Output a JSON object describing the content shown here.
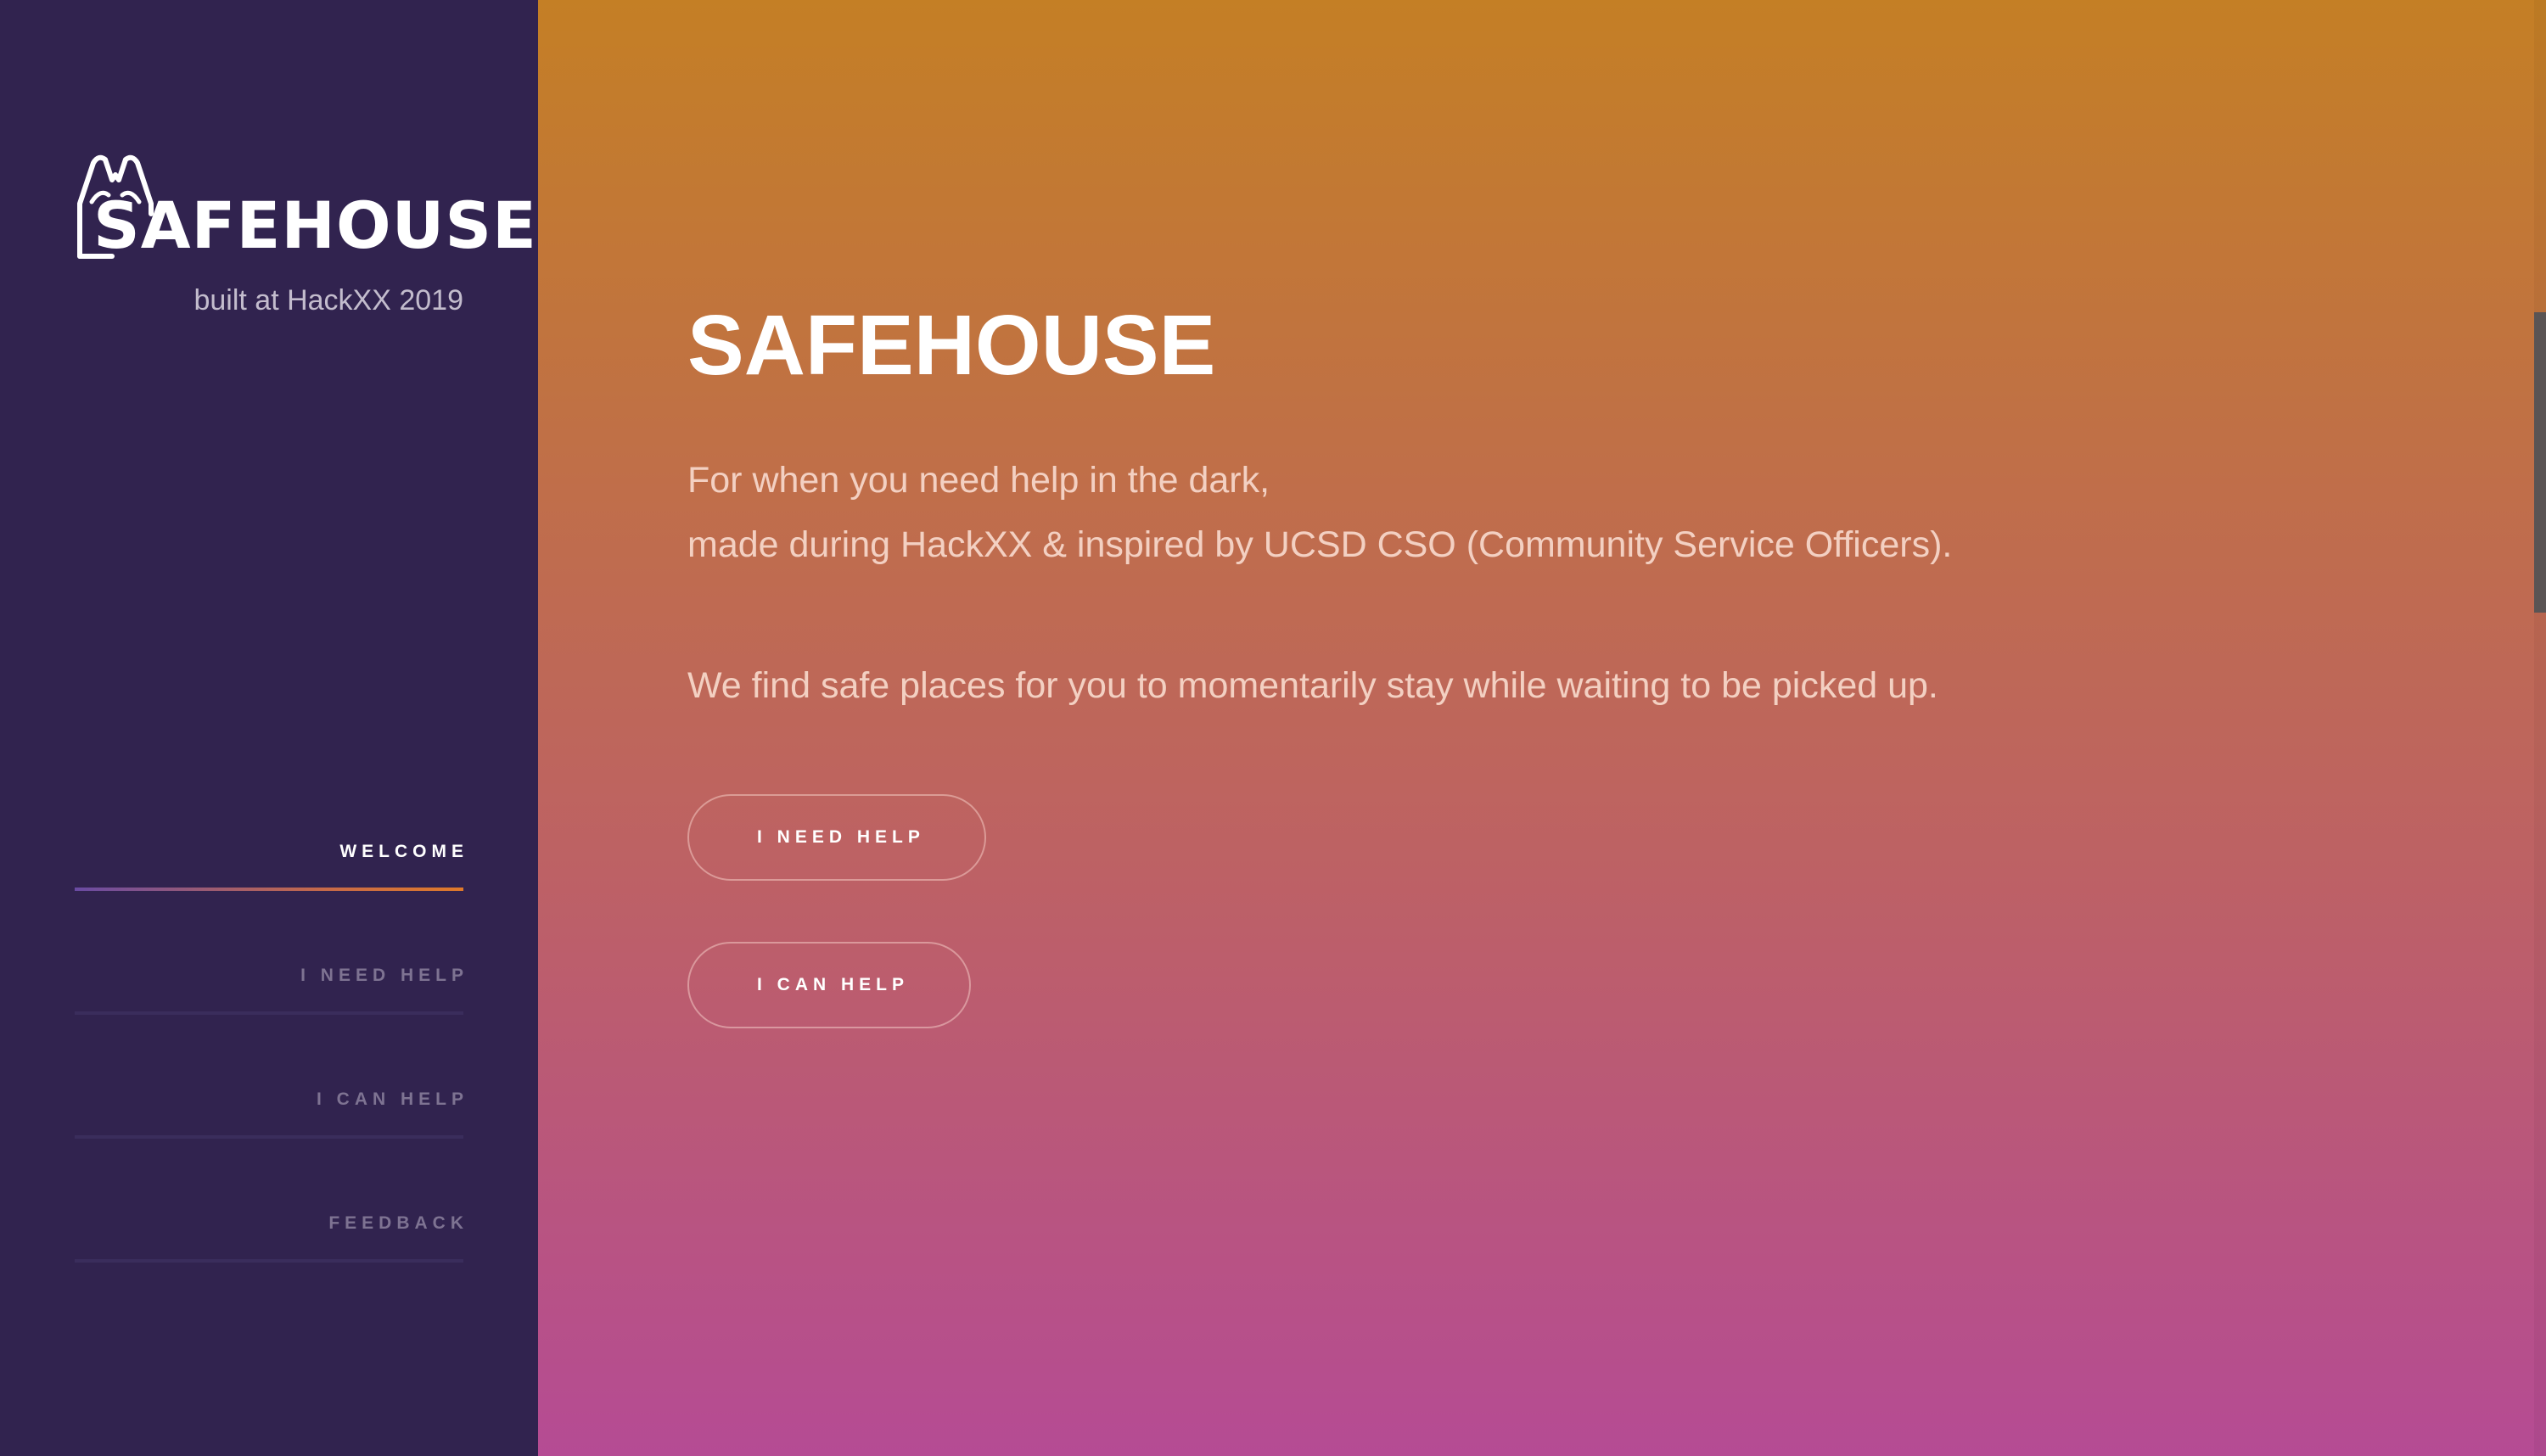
{
  "sidebar": {
    "brand": "SAFEHOUSE",
    "tagline": "built at HackXX 2019",
    "nav": {
      "items": [
        {
          "label": "WELCOME",
          "active": true
        },
        {
          "label": "I NEED HELP",
          "active": false
        },
        {
          "label": "I CAN HELP",
          "active": false
        },
        {
          "label": "FEEDBACK",
          "active": false
        }
      ]
    }
  },
  "main": {
    "title": "SAFEHOUSE",
    "description_lines": [
      "For when you need help in the dark,",
      "made during HackXX & inspired by UCSD CSO (Community Service Officers).",
      "We find safe places for you to momentarily stay while waiting to be picked up."
    ],
    "buttons": {
      "need_help": "I NEED HELP",
      "can_help": "I CAN HELP"
    }
  },
  "colors": {
    "sidebar_bg": "#31234f",
    "gradient_top": "#c47f25",
    "gradient_bottom": "#b54b94",
    "nav_active_text": "#ffffff",
    "nav_inactive_text": "#7e7392"
  },
  "icons": {
    "logo": "hands-house-icon"
  }
}
